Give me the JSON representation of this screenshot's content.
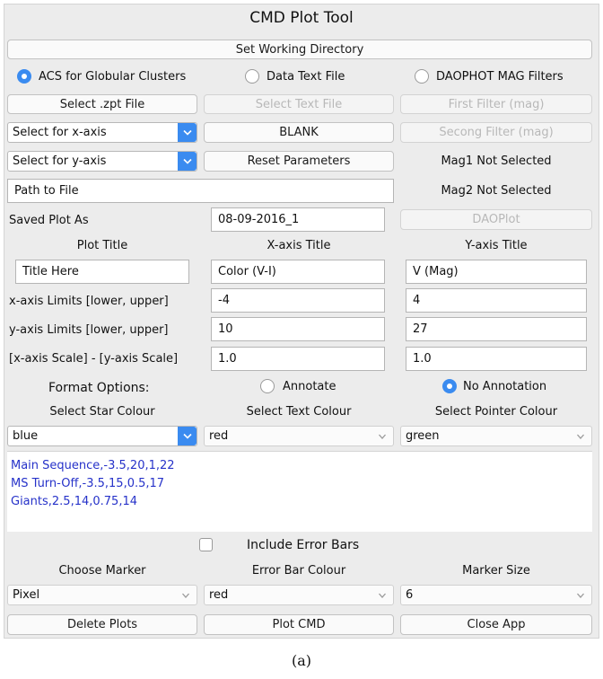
{
  "app_title": "CMD Plot Tool",
  "set_working_dir": "Set Working Directory",
  "radios": {
    "acs": "ACS for Globular Clusters",
    "data_text": "Data Text File",
    "daophot": "DAOPHOT MAG Filters"
  },
  "buttons": {
    "select_zpt": "Select .zpt File",
    "select_text": "Select Text File",
    "first_filter": "First Filter (mag)",
    "blank": "BLANK",
    "second_filter": "Secong Filter (mag)",
    "reset": "Reset Parameters",
    "daoplot": "DAOPlot",
    "delete_plots": "Delete Plots",
    "plot_cmd": "Plot CMD",
    "close_app": "Close App"
  },
  "combos": {
    "x_axis": "Select for x-axis",
    "y_axis": "Select for y-axis"
  },
  "status": {
    "mag1": "Mag1 Not Selected",
    "mag2": "Mag2 Not Selected"
  },
  "path_field": "Path to File",
  "saved_plot_label": "Saved Plot As",
  "saved_plot_value": "08-09-2016_1",
  "headers": {
    "plot_title": "Plot Title",
    "x_title": "X-axis Title",
    "y_title": "Y-axis Title"
  },
  "fields": {
    "plot_title": "Title Here",
    "x_title": "Color (V-I)",
    "y_title": "V (Mag)"
  },
  "limits": {
    "x_label": "x-axis Limits [lower, upper]",
    "x_lower": "-4",
    "x_upper": "4",
    "y_label": "y-axis Limits [lower, upper]",
    "y_lower": "10",
    "y_upper": "27",
    "scale_label": "[x-axis Scale] - [y-axis Scale]",
    "x_scale": "1.0",
    "y_scale": "1.0"
  },
  "format": {
    "label": "Format Options:",
    "annotate": "Annotate",
    "no_annotation": "No Annotation"
  },
  "colours": {
    "star_label": "Select Star Colour",
    "text_label": "Select Text Colour",
    "pointer_label": "Select Pointer Colour",
    "star": "blue",
    "text": "red",
    "pointer": "green"
  },
  "annotations": [
    "Main Sequence,-3.5,20,1,22",
    "MS Turn-Off,-3.5,15,0.5,17",
    "Giants,2.5,14,0.75,14"
  ],
  "error_bars_label": "Include Error Bars",
  "marker": {
    "choose_label": "Choose Marker",
    "errbar_label": "Error Bar Colour",
    "size_label": "Marker Size",
    "marker": "Pixel",
    "errbar": "red",
    "size": "6"
  },
  "caption": "(a)",
  "accent_color": "#3a8bf0",
  "annotation_text_color": "#2632c9"
}
